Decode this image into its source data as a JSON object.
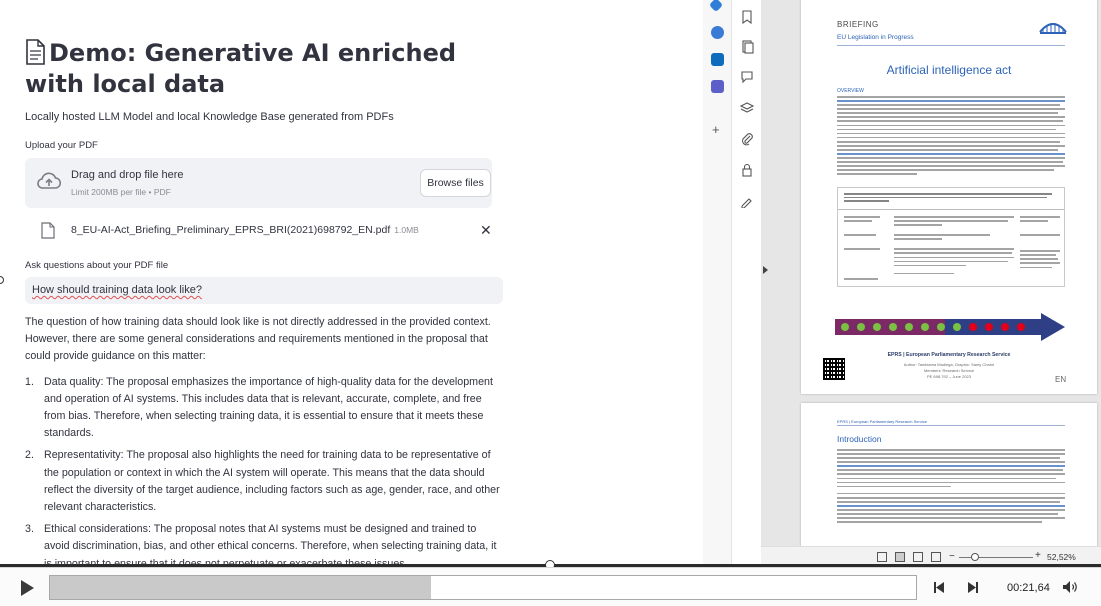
{
  "app": {
    "title": "Demo: Generative AI enriched with local data",
    "subtitle": "Locally hosted LLM Model and local Knowledge Base generated from PDFs",
    "upload_label": "Upload your PDF",
    "dropzone": {
      "title": "Drag and drop file here",
      "limit": "Limit 200MB per file • PDF",
      "browse_label": "Browse files"
    },
    "uploaded_file": {
      "name": "8_EU-AI-Act_Briefing_Preliminary_EPRS_BRI(2021)698792_EN.pdf",
      "size": "1.0MB"
    },
    "question_label": "Ask questions about your PDF file",
    "question_value": "How should training data look like?",
    "answer": {
      "intro": "The question of how training data should look like is not directly addressed in the provided context. However, there are some general considerations and requirements mentioned in the proposal that could provide guidance on this matter:",
      "items": [
        {
          "num": "1.",
          "text": "Data quality: The proposal emphasizes the importance of high-quality data for the development and operation of AI systems. This includes data that is relevant, accurate, complete, and free from bias. Therefore, when selecting training data, it is essential to ensure that it meets these standards."
        },
        {
          "num": "2.",
          "text": "Representativity: The proposal also highlights the need for training data to be representative of the population or context in which the AI system will operate. This means that the data should reflect the diversity of the target audience, including factors such as age, gender, race, and other relevant characteristics."
        },
        {
          "num": "3.",
          "text": "Ethical considerations: The proposal notes that AI systems must be designed and trained to avoid discrimination, bias, and other ethical concerns. Therefore, when selecting training data, it is important to ensure that it does not perpetuate or exacerbate these issues."
        }
      ]
    }
  },
  "pdf": {
    "page1": {
      "briefing": "BRIEFING",
      "series": "EU Legislation in Progress",
      "title": "Artificial intelligence act",
      "overview": "OVERVIEW",
      "eprs": "EPRS | European Parliamentary Research Service",
      "authors": "Author: Tambiama Madiega; Graphic: Samy Chahri",
      "dept": "Members' Research Service",
      "ref": "PE 698.792 – June 2023",
      "lang": "EN"
    },
    "page2": {
      "header": "EPRS | European Parliamentary Research Service",
      "heading": "Introduction"
    },
    "zoom": "52,52%"
  },
  "video": {
    "time": "00:21,64",
    "progress": 0.44
  },
  "colors": {
    "text": "#31333f",
    "eu_blue": "#2c63b8",
    "panel": "#f0f2f6"
  }
}
